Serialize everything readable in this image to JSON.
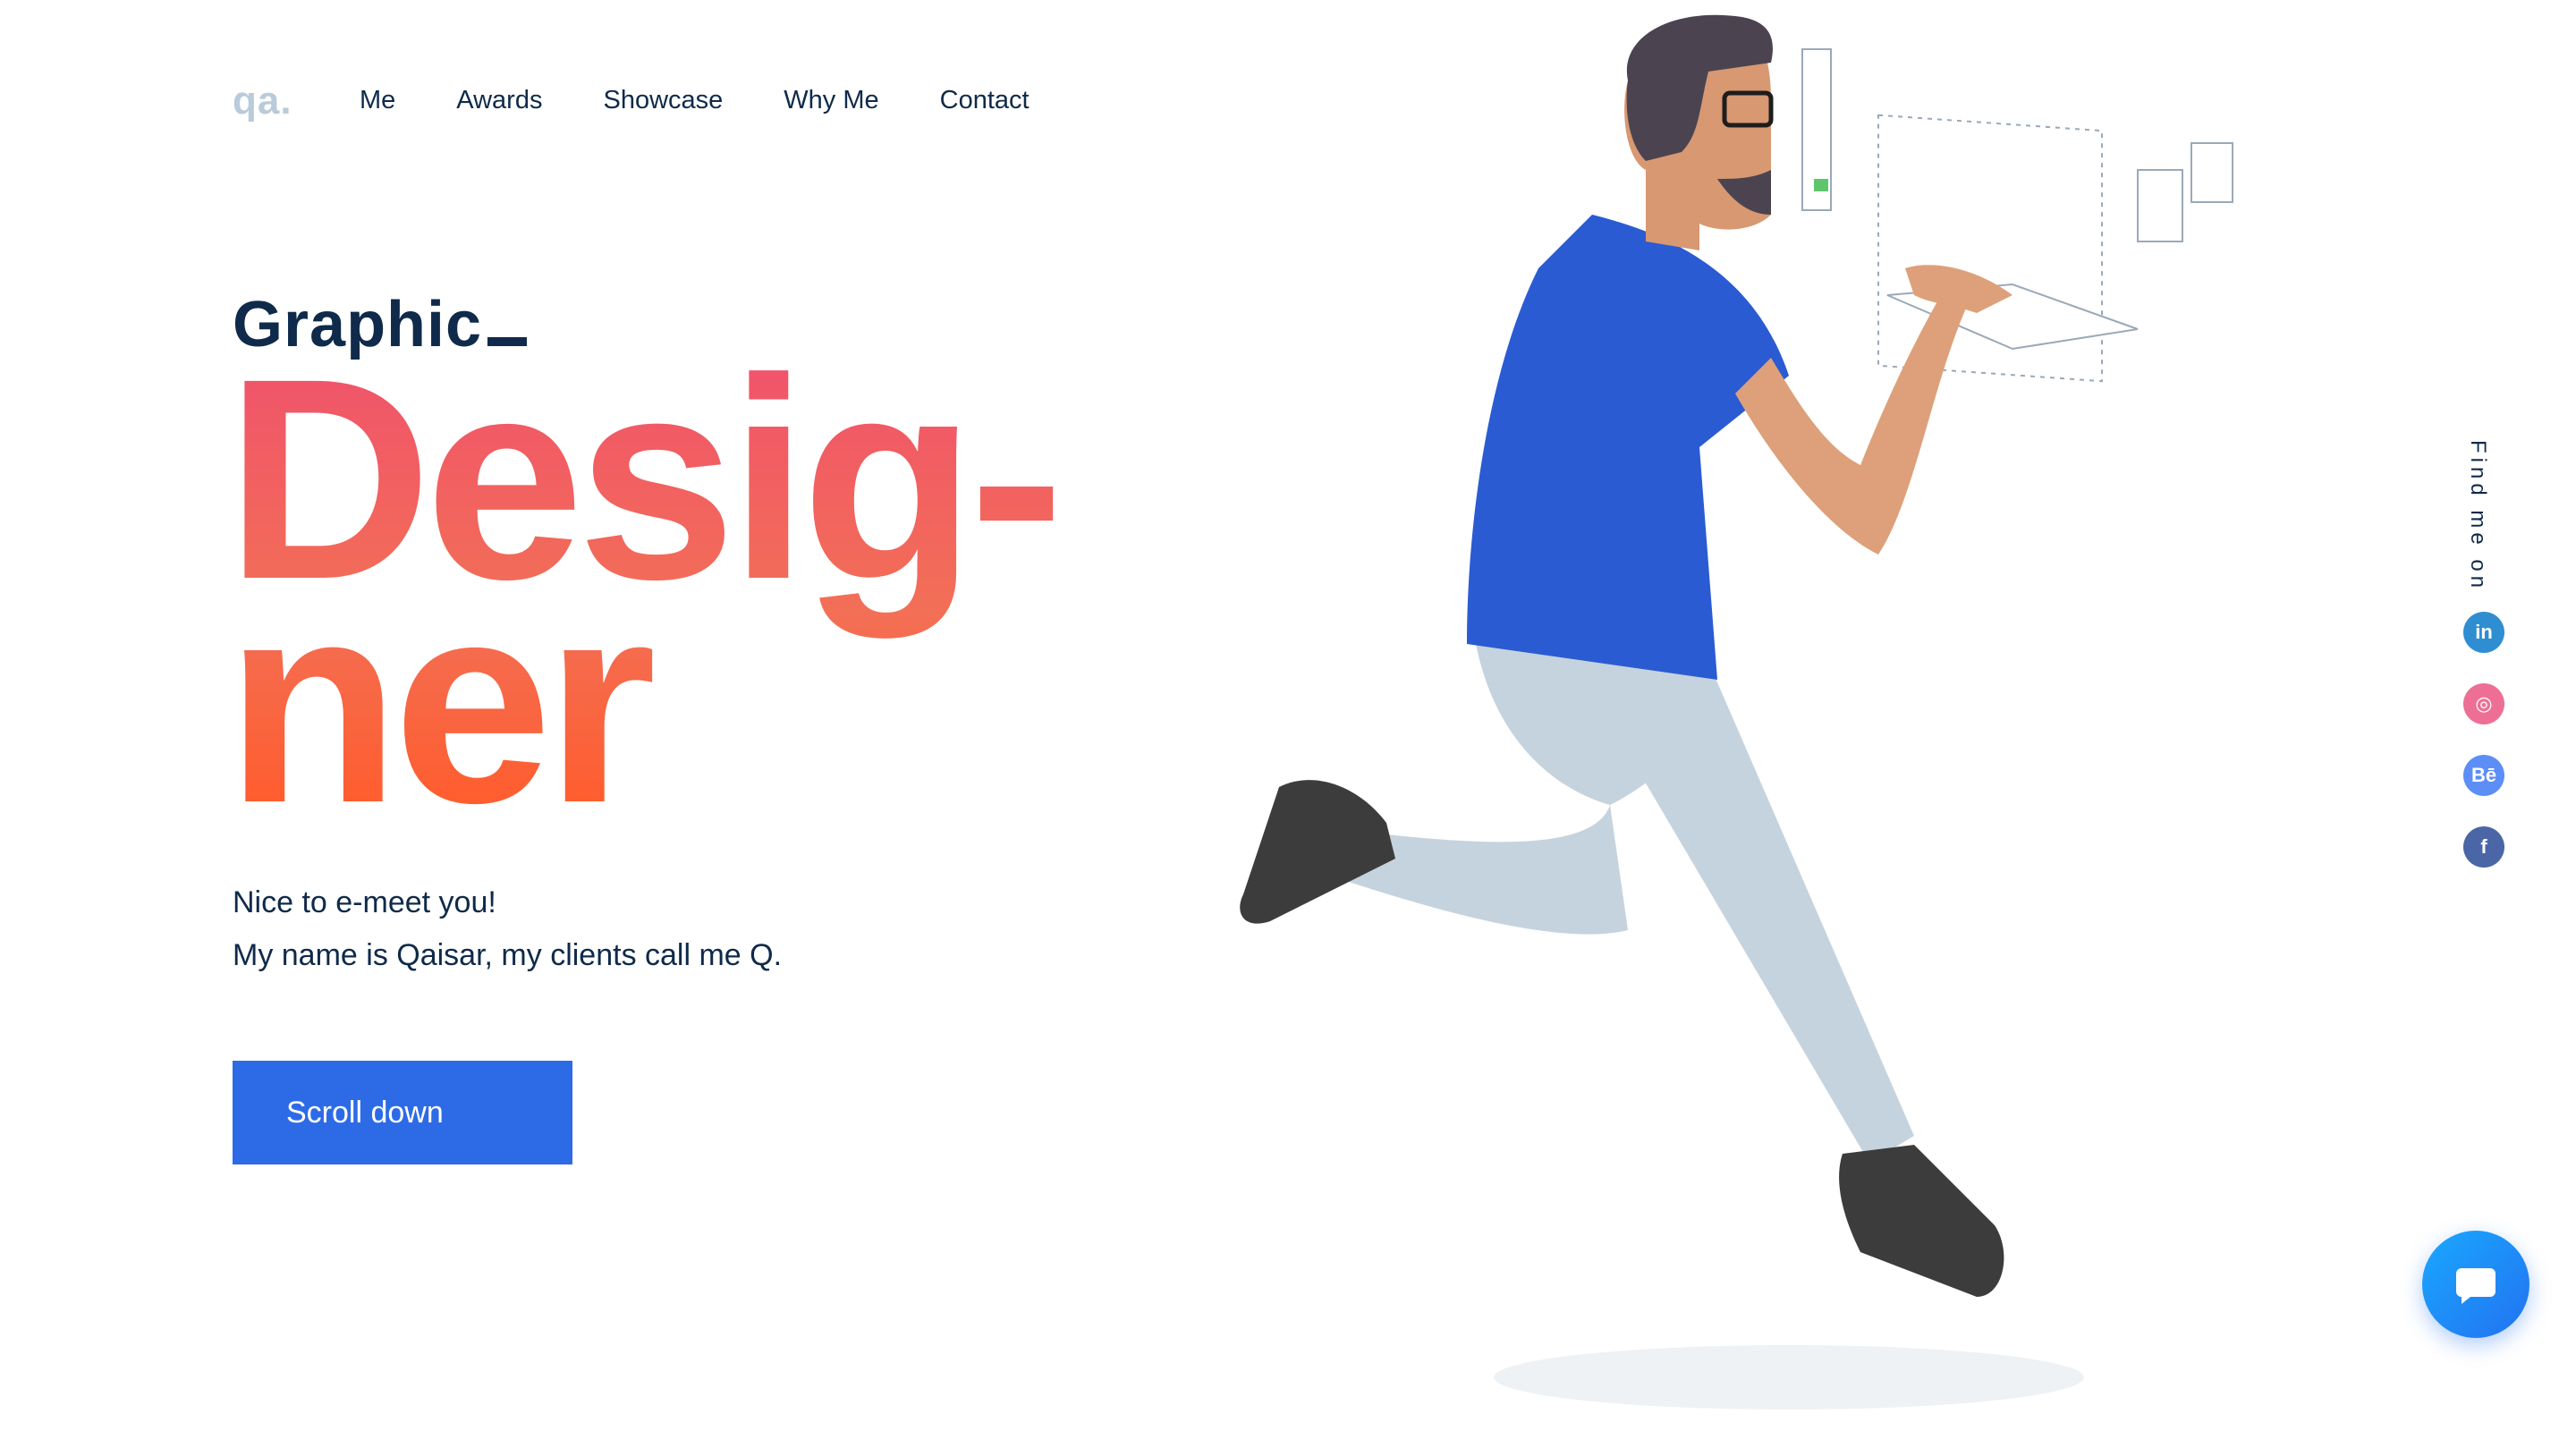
{
  "logo": "qa.",
  "nav": [
    "Me",
    "Awards",
    "Showcase",
    "Why Me",
    "Contact"
  ],
  "hero": {
    "kicker": "Graphic",
    "title_line1": "Desig-",
    "title_line2": "ner",
    "intro_line1": "Nice to e-meet you!",
    "intro_line2": "My name is Qaisar, my clients call me Q.",
    "button": "Scroll down"
  },
  "social": {
    "label": "Find me on",
    "items": [
      {
        "name": "linkedin",
        "glyph": "in",
        "color": "#2f8ed1"
      },
      {
        "name": "dribbble",
        "glyph": "◎",
        "color": "#ee6f96"
      },
      {
        "name": "behance",
        "glyph": "Bē",
        "color": "#5d8ef5"
      },
      {
        "name": "facebook",
        "glyph": "f",
        "color": "#4a66a6"
      }
    ]
  },
  "colors": {
    "navy": "#0f2a4a",
    "brand_blue": "#2d6be6",
    "title_gradient_top": "#f0546a",
    "title_gradient_bottom": "#ff5c2c"
  }
}
